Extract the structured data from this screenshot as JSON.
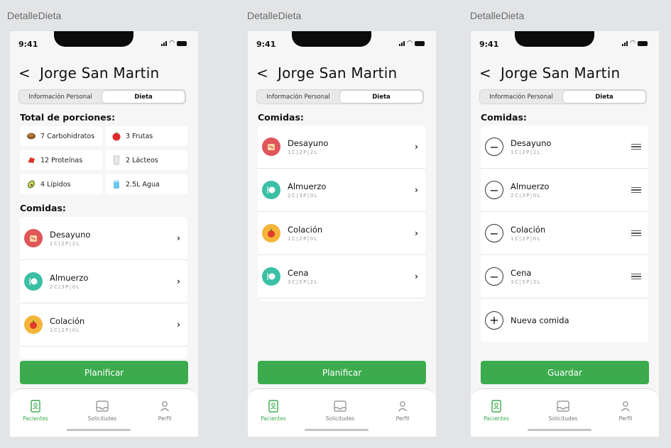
{
  "frames": [
    {
      "label": "DetalleDieta"
    },
    {
      "label": "DetalleDieta"
    },
    {
      "label": "DetalleDieta"
    }
  ],
  "status": {
    "time": "9:41"
  },
  "header": {
    "back": "<",
    "title": "Jorge San Martin"
  },
  "tabs": [
    "Información Personal",
    "Dieta"
  ],
  "portions_title": "Total de porciones:",
  "portions": [
    {
      "icon": "potato-icon",
      "label": "7 Carbohidratos"
    },
    {
      "icon": "apple-icon",
      "label": "3 Frutas"
    },
    {
      "icon": "meat-icon",
      "label": "12 Proteínas"
    },
    {
      "icon": "milk-icon",
      "label": "2 Lácteos"
    },
    {
      "icon": "avocado-icon",
      "label": "4 Lípidos"
    },
    {
      "icon": "water-icon",
      "label": "2.5L Agua"
    }
  ],
  "meals_title": "Comidas:",
  "meals": [
    {
      "name": "Desayuno",
      "sub": "1C|2P|2L",
      "icon": "toast-icon",
      "color": "#e0565b"
    },
    {
      "name": "Almuerzo",
      "sub": "2C|3P|0L",
      "icon": "plate-icon",
      "color": "#3bbfa5"
    },
    {
      "name": "Colación",
      "sub": "1C|2P|0L",
      "icon": "apple-icon",
      "color": "#f3b53a"
    },
    {
      "name": "Cena",
      "sub": "3C|5P|2L",
      "icon": "plate-icon",
      "color": "#3bbfa5"
    }
  ],
  "new_meal": "Nueva comida",
  "buttons": {
    "plan": "Planificar",
    "save": "Guardar"
  },
  "nav": {
    "patients": "Pacientes",
    "requests": "Solicitudes",
    "profile": "Perfil"
  },
  "colors": {
    "accent": "#3cab4e",
    "background": "#f6f6f6"
  }
}
